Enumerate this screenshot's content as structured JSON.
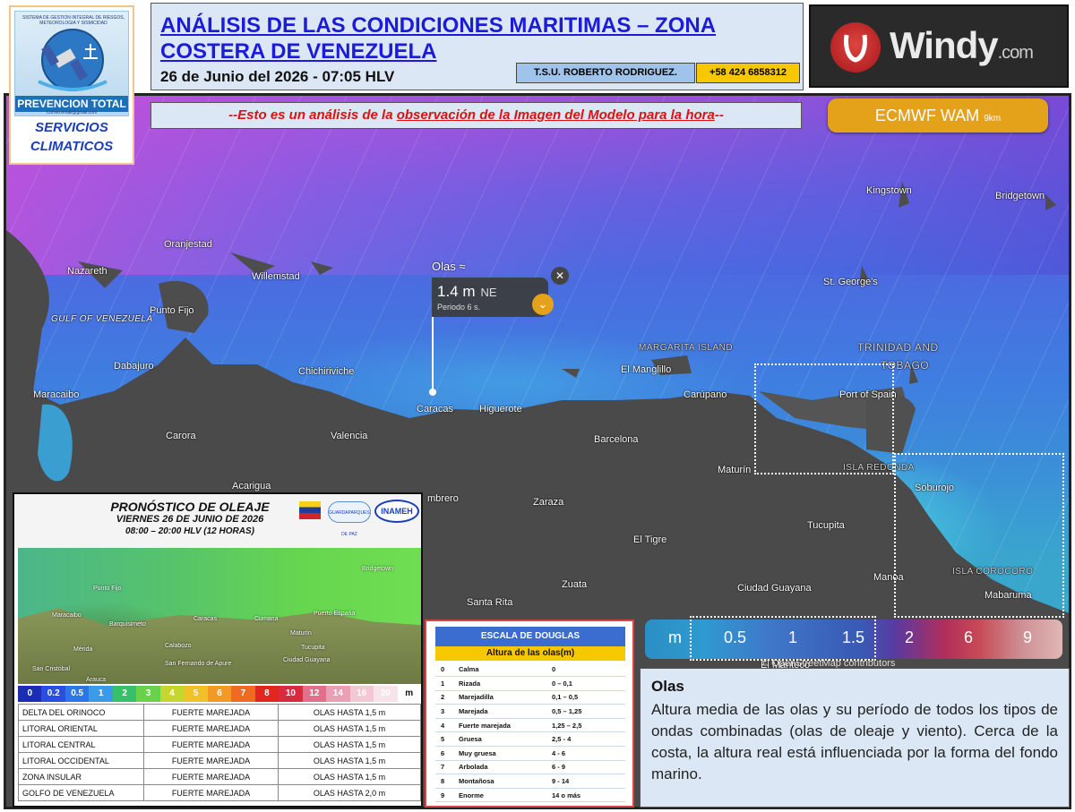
{
  "header": {
    "title": "ANÁLISIS DE LAS CONDICIONES MARITIMAS – ZONA COSTERA DE VENEZUELA",
    "date_line": "26 de Junio del 2026 - 07:05 HLV",
    "author": "T.S.U. ROBERTO RODRIGUEZ.",
    "phone": "+58 424 6858312"
  },
  "logo": {
    "small_text": "SISTEMA DE GESTION INTEGRAL DE RIESGOS, METEOROLOGIA Y SISMICIDAD",
    "name": "PREVENCION TOTAL",
    "email": "Correo.email@gmail.com",
    "sub_line1": "SERVICIOS",
    "sub_line2": "CLIMATICOS"
  },
  "windy": {
    "brand": "Windy",
    "suffix": ".com"
  },
  "note": {
    "prefix": "--Esto es un análisis de la ",
    "underlined": "observación de la Imagen del Modelo para la hora",
    "suffix": "--"
  },
  "model": {
    "name": "ECMWF WAM",
    "resolution": "9km"
  },
  "popup": {
    "label": "Olas ≈",
    "value": "1.4 m",
    "direction": "NE",
    "period": "Periodo 6 s.",
    "close_symbol": "✕",
    "toggle_symbol": "⌄"
  },
  "places": {
    "oranjestad": "Oranjestad",
    "nazareth": "Nazareth",
    "willemstad": "Willemstad",
    "punto_fijo": "Punto Fijo",
    "gulf": "GULF OF VENEZUELA",
    "dabajuro": "Dabajuro",
    "chichiriviche": "Chichiriviche",
    "maracaibo": "Maracaibo",
    "caracas": "Caracas",
    "higuerote": "Higuerote",
    "carora": "Carora",
    "valencia": "Valencia",
    "acarigua": "Acarigua",
    "margarita": "MARGARITA ISLAND",
    "el_manglillo": "El Manglillo",
    "carupano": "Carúpano",
    "barcelona": "Barcelona",
    "trinidad": "TRINIDAD AND",
    "tobago": "TOBAGO",
    "port_of_spain": "Port of Spain",
    "kingstown": "Kingstown",
    "bridgetown": "Bridgetown",
    "st_georges": "St. George's",
    "maturin": "Maturín",
    "isla_redonda": "ISLA REDONDA",
    "soburojo": "Soburojo",
    "zaraza": "Zaraza",
    "el_tigre": "El Tigre",
    "tucupita": "Tucupita",
    "zuata": "Zuata",
    "santa_rita": "Santa Rita",
    "ciudad_guayana": "Ciudad Guayana",
    "manoa": "Manoa",
    "isla_corocoro": "ISLA COROCORO",
    "mabaruma": "Mabaruma",
    "el_manteco": "El Manteco",
    "sombrero": "mbrero"
  },
  "legend": {
    "unit": "m",
    "stops": [
      "0.5",
      "1",
      "1.5",
      "2",
      "6",
      "9"
    ]
  },
  "attribution": "© OpenStreetMap contributors",
  "description": {
    "heading": "Olas",
    "text": "Altura media de las olas y su período de todos los tipos de ondas combinadas (olas de oleaje y viento). Cerca de la costa, la altura real está influenciada por la forma del fondo marino."
  },
  "forecast": {
    "title": "PRONÓSTICO DE OLEAJE",
    "day": "VIERNES 26 DE JUNIO DE 2026",
    "hours": "08:00 – 20:00 HLV  (12 HORAS)",
    "org": "INAMEH",
    "org2": "GUARDAPARQUES DE PAZ",
    "map_labels": {
      "pto": "Punto Fijo",
      "mcb": "Maracaibo",
      "bqm": "Barquisimeto",
      "ccs": "Caracas",
      "cum": "Cumana",
      "pos": "Puerto España",
      "brg": "Bridgetown",
      "mtn": "Maturín",
      "cal": "Calabozo",
      "tcp": "Tucupita",
      "cgy": "Ciudad Guayana",
      "sfa": "San Fernando de Apure",
      "scr": "San Cristóbal",
      "ara": "Arauca",
      "mer": "Mérida"
    },
    "scale_colors": [
      "#1b2db5",
      "#2a4ee0",
      "#2e76e8",
      "#3b9be8",
      "#36c06a",
      "#6ad14a",
      "#c6d62e",
      "#f1c12a",
      "#f29a24",
      "#ef6a22",
      "#e0261f",
      "#d92a3f",
      "#e2708a",
      "#eaa0b4",
      "#f3c7d3",
      "#f7e4ea",
      "#ffffff"
    ],
    "scale_labels": [
      "0",
      "0.2",
      "0.5",
      "1",
      "2",
      "3",
      "4",
      "5",
      "6",
      "7",
      "8",
      "10",
      "12",
      "14",
      "16",
      "20",
      "m"
    ],
    "rows": [
      {
        "zone": "DELTA DEL ORINOCO",
        "state": "FUERTE MAREJADA",
        "height": "OLAS HASTA 1,5 m"
      },
      {
        "zone": "LITORAL ORIENTAL",
        "state": "FUERTE MAREJADA",
        "height": "OLAS HASTA 1,5 m"
      },
      {
        "zone": "LITORAL CENTRAL",
        "state": "FUERTE MAREJADA",
        "height": "OLAS HASTA 1,5 m"
      },
      {
        "zone": "LITORAL OCCIDENTAL",
        "state": "FUERTE MAREJADA",
        "height": "OLAS HASTA 1,5 m"
      },
      {
        "zone": "ZONA INSULAR",
        "state": "FUERTE MAREJADA",
        "height": "OLAS HASTA 1,5 m"
      },
      {
        "zone": "GOLFO DE VENEZUELA",
        "state": "FUERTE MAREJADA",
        "height": "OLAS HASTA 2,0 m"
      }
    ]
  },
  "douglas": {
    "title": "ESCALA DE DOUGLAS",
    "subtitle": "Altura de las olas(m)",
    "rows": [
      {
        "n": "0",
        "desc": "Calma",
        "h": "0"
      },
      {
        "n": "1",
        "desc": "Rizada",
        "h": "0 – 0,1"
      },
      {
        "n": "2",
        "desc": "Marejadilla",
        "h": "0,1 – 0,5"
      },
      {
        "n": "3",
        "desc": "Marejada",
        "h": "0,5 – 1,25"
      },
      {
        "n": "4",
        "desc": "Fuerte marejada",
        "h": "1,25 – 2,5"
      },
      {
        "n": "5",
        "desc": "Gruesa",
        "h": "2,5 - 4"
      },
      {
        "n": "6",
        "desc": "Muy gruesa",
        "h": "4 - 6"
      },
      {
        "n": "7",
        "desc": "Arbolada",
        "h": "6 - 9"
      },
      {
        "n": "8",
        "desc": "Montañosa",
        "h": "9 - 14"
      },
      {
        "n": "9",
        "desc": "Enorme",
        "h": "14 o más"
      }
    ]
  }
}
